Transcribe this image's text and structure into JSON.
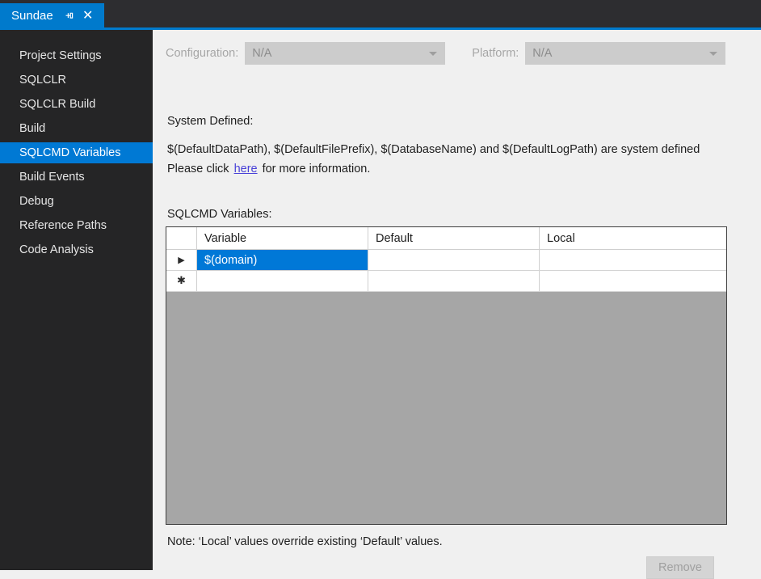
{
  "window": {
    "tab": {
      "title": "Sundae",
      "pin_icon": "pin-icon",
      "close_icon": "close-icon",
      "close_glyph": "✕",
      "pin_glyph": "⊣"
    },
    "accent_color": "#007acc"
  },
  "sidebar": {
    "background": "#252526",
    "selected_color": "#0079d4",
    "items": [
      {
        "label": "Project Settings",
        "selected": false
      },
      {
        "label": "SQLCLR",
        "selected": false
      },
      {
        "label": "SQLCLR Build",
        "selected": false
      },
      {
        "label": "Build",
        "selected": false
      },
      {
        "label": "SQLCMD Variables",
        "selected": true
      },
      {
        "label": "Build Events",
        "selected": false
      },
      {
        "label": "Debug",
        "selected": false
      },
      {
        "label": "Reference Paths",
        "selected": false
      },
      {
        "label": "Code Analysis",
        "selected": false
      }
    ]
  },
  "toolbar": {
    "configuration_label": "Configuration:",
    "configuration_value": "N/A",
    "platform_label": "Platform:",
    "platform_value": "N/A"
  },
  "system_defined": {
    "heading": "System Defined:",
    "line1": "$(DefaultDataPath), $(DefaultFilePrefix), $(DatabaseName) and $(DefaultLogPath) are system defined",
    "line2_before": "Please click",
    "link_text": "here",
    "line2_after": "for more information.",
    "link_color": "#4a42d8"
  },
  "grid": {
    "label": "SQLCMD Variables:",
    "selection_color": "#0078d7",
    "columns": [
      "",
      "Variable",
      "Default",
      "Local"
    ],
    "rows": [
      {
        "selector_glyph": "▶",
        "selector_name": "current-row-indicator",
        "variable": "$(domain)",
        "default": "",
        "local": "",
        "selected": true
      },
      {
        "selector_glyph": "✱",
        "selector_name": "new-row-indicator",
        "variable": "",
        "default": "",
        "local": "",
        "selected": false
      }
    ]
  },
  "footer": {
    "note": "Note: ‘Local’ values override existing ‘Default’ values.",
    "remove_label": "Remove",
    "remove_enabled": false
  }
}
